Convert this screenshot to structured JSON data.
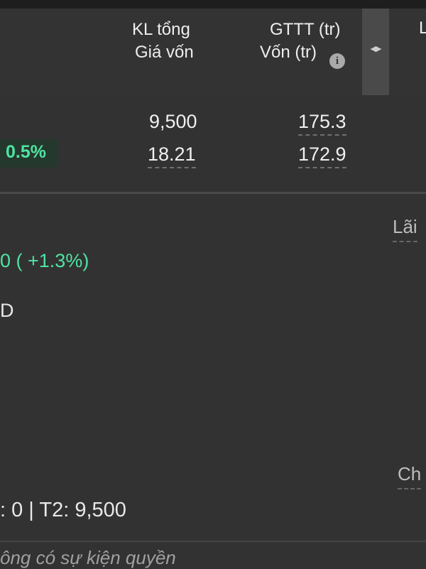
{
  "table": {
    "columns": {
      "kl": {
        "line1": "KL tổng",
        "line2": "Giá vốn"
      },
      "gttt": {
        "line1": "GTTT (tr)",
        "line2": "Vốn (tr)"
      },
      "next": "L"
    },
    "row": {
      "change_pct": "0.5%",
      "kl_total": "9,500",
      "cost_price": "18.21",
      "market_value": "175.3",
      "capital": "172.9"
    }
  },
  "detail": {
    "profit_label": "Lãi",
    "profit_change": "0 ( +1.3%)",
    "currency_fragment": "D",
    "waiting_label": "Ch",
    "settlement": ": 0 | T2: 9,500",
    "events_note": "ông có sự kiện quyền"
  },
  "colors": {
    "background": "#323232",
    "positive": "#4fe3a3",
    "text": "#e8e8e8"
  },
  "icons": {
    "info": "info-icon",
    "resize": "resize-arrows-icon"
  }
}
